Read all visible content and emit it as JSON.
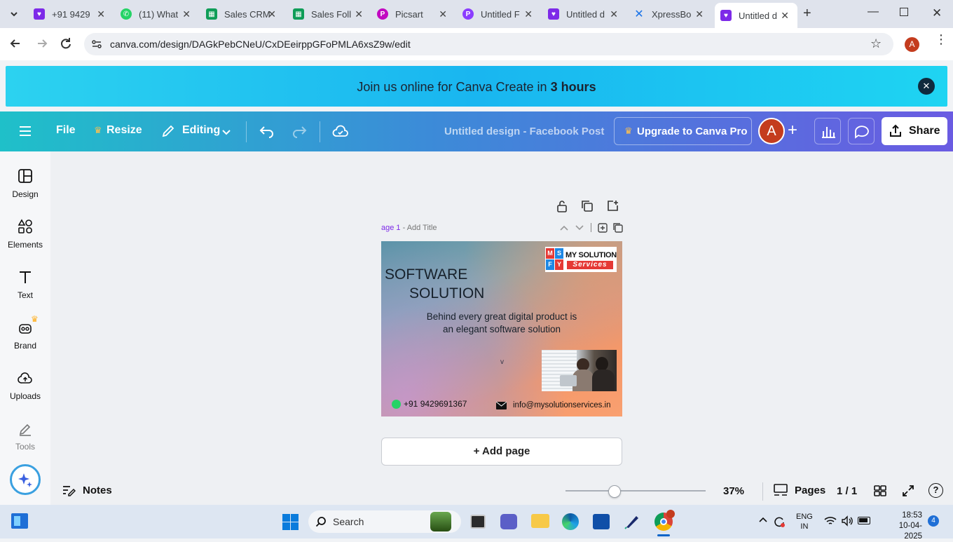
{
  "browser": {
    "tabs": [
      {
        "label": "+91 9429",
        "icon": "canva-heart-icon",
        "color": "#7d2ae8"
      },
      {
        "label": "(11) What",
        "icon": "whatsapp-icon",
        "color": "#25d366"
      },
      {
        "label": "Sales CRM",
        "icon": "sheets-icon",
        "color": "#0f9d58"
      },
      {
        "label": "Sales Foll",
        "icon": "sheets-icon",
        "color": "#0f9d58"
      },
      {
        "label": "Picsart",
        "icon": "picsart-icon",
        "color": "#c209c1"
      },
      {
        "label": "Untitled F",
        "icon": "picsart-icon",
        "color": "#8b3dff"
      },
      {
        "label": "Untitled d",
        "icon": "canva-heart-icon",
        "color": "#7d2ae8"
      },
      {
        "label": "XpressBo",
        "icon": "x-icon",
        "color": "#1a73e8"
      },
      {
        "label": "Untitled d",
        "icon": "canva-heart-icon",
        "color": "#7d2ae8"
      }
    ],
    "url": "canva.com/design/DAGkPebCNeU/CxDEeirppGFoPMLA6xsZ9w/edit",
    "profile_initial": "A"
  },
  "banner": {
    "text_before": "Join us online for Canva Create in ",
    "text_bold": "3 hours"
  },
  "toolbar": {
    "file": "File",
    "resize": "Resize",
    "editing": "Editing",
    "title": "Untitled design - Facebook Post",
    "upgrade": "Upgrade to Canva Pro",
    "avatar": "A",
    "share": "Share"
  },
  "rail": {
    "items": [
      {
        "label": "Design",
        "icon": "layout-icon"
      },
      {
        "label": "Elements",
        "icon": "shapes-icon"
      },
      {
        "label": "Text",
        "icon": "text-t-icon"
      },
      {
        "label": "Brand",
        "icon": "brand-crown-icon"
      },
      {
        "label": "Uploads",
        "icon": "cloud-upload-icon"
      },
      {
        "label": "Tools",
        "icon": "pen-tool-icon"
      }
    ]
  },
  "page": {
    "label": "age 1",
    "dash": "-",
    "add_title": "Add Title"
  },
  "design": {
    "logo_letters": [
      "M",
      "S",
      "F",
      "Y"
    ],
    "logo_line1": "MY SOLUTION",
    "logo_line2": "Services",
    "headline1": "SOFTWARE",
    "headline2": "SOLUTION",
    "body": "Behind every great digital product is an elegant software solution",
    "phone": "+91 9429691367",
    "email": "info@mysolutionservices.in",
    "chevron": "v"
  },
  "add_page": "+ Add page",
  "footer": {
    "notes": "Notes",
    "zoom": "37%",
    "zoom_level": 0.37,
    "pages": "Pages",
    "page_count": "1 / 1"
  },
  "taskbar": {
    "search": "Search",
    "lang1": "ENG",
    "lang2": "IN",
    "time": "18:53",
    "date": "10-04-2025",
    "notif": "4"
  }
}
